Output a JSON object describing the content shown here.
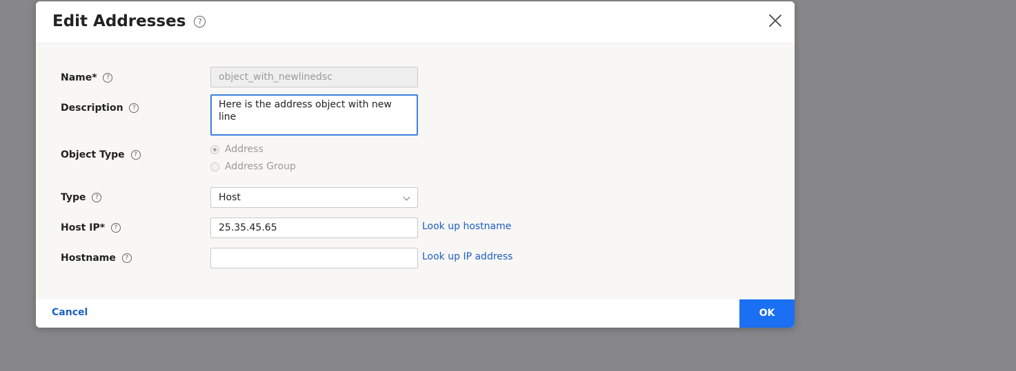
{
  "dialog": {
    "title": "Edit Addresses",
    "help_glyph": "?"
  },
  "form": {
    "name": {
      "label": "Name*",
      "value": "object_with_newlinedsc"
    },
    "description": {
      "label": "Description",
      "value": "Here is the address object with new line"
    },
    "object_type": {
      "label": "Object Type",
      "options": [
        "Address",
        "Address Group"
      ],
      "selected": "Address"
    },
    "type": {
      "label": "Type",
      "value": "Host"
    },
    "host_ip": {
      "label": "Host IP*",
      "value": "25.35.45.65",
      "link": "Look up hostname"
    },
    "hostname": {
      "label": "Hostname",
      "value": "",
      "link": "Look up IP address"
    }
  },
  "footer": {
    "cancel_label": "Cancel",
    "ok_label": "OK"
  },
  "colors": {
    "accent": "#1a6ff2",
    "link": "#1f5fbf",
    "backdrop": "#87878a"
  }
}
